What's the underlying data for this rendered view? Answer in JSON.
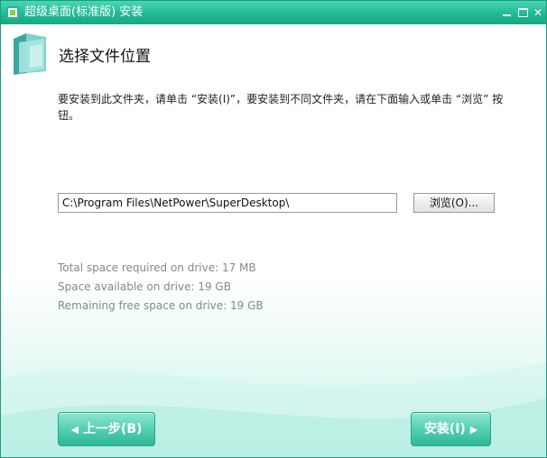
{
  "window": {
    "title": "超级桌面(标准版) 安装"
  },
  "page": {
    "title": "选择文件位置",
    "description": "要安装到此文件夹，请单击 “安装(I)”，要安装到不同文件夹，请在下面输入或单击 “浏览” 按钮。"
  },
  "install_path": {
    "value": "C:\\Program Files\\NetPower\\SuperDesktop\\"
  },
  "browse": {
    "label": "浏览(O)..."
  },
  "space": {
    "required": "Total space required on drive: 17 MB",
    "available": "Space available on drive: 19 GB",
    "remaining": "Remaining free space on drive: 19 GB"
  },
  "buttons": {
    "back": "上一步(B)",
    "install": "安装(I)"
  },
  "icons": {
    "app": "app-icon",
    "folder": "folder-icon",
    "minimize": "minimize-icon",
    "maximize": "maximize-icon",
    "close": "close-icon"
  },
  "colors": {
    "titlebar": "#22b994",
    "accent": "#2db796",
    "button_border": "#22a786"
  }
}
